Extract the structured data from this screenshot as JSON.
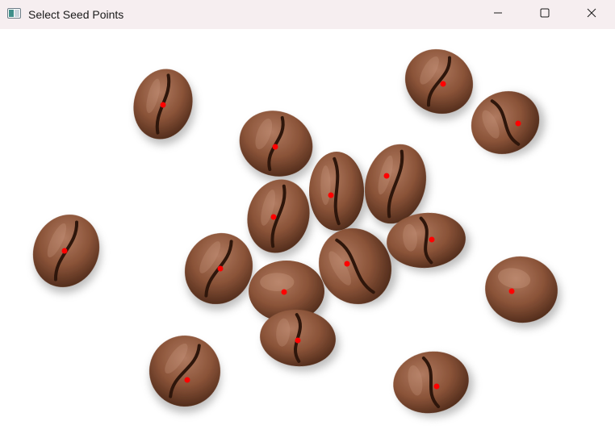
{
  "window": {
    "title": "Select Seed Points",
    "icons": {
      "app": "image-viewer-icon",
      "minimize": "minimize-icon",
      "maximize": "maximize-icon",
      "close": "close-icon"
    }
  },
  "canvas": {
    "content": "coffee-beans-image",
    "seed_color": "#ff0000",
    "bean_color": "#8a5338"
  }
}
